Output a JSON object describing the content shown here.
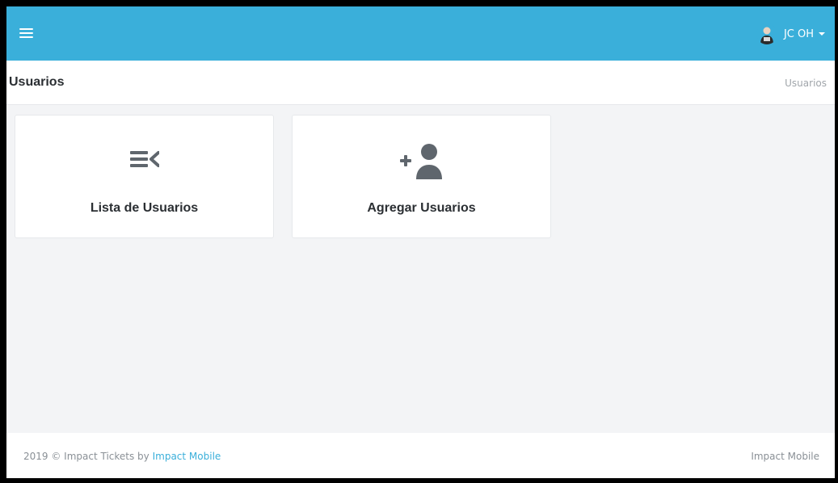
{
  "header": {
    "user_name": "JC OH",
    "accent_color": "#3aafda"
  },
  "page": {
    "title": "Usuarios",
    "breadcrumb": "Usuarios"
  },
  "cards": [
    {
      "label": "Lista de Usuarios",
      "icon": "list-arrow-icon"
    },
    {
      "label": "Agregar Usuarios",
      "icon": "add-user-icon"
    }
  ],
  "footer": {
    "copyright_prefix": "2019 © Impact Tickets by",
    "company_link": "Impact Mobile",
    "right_text": "Impact Mobile"
  }
}
